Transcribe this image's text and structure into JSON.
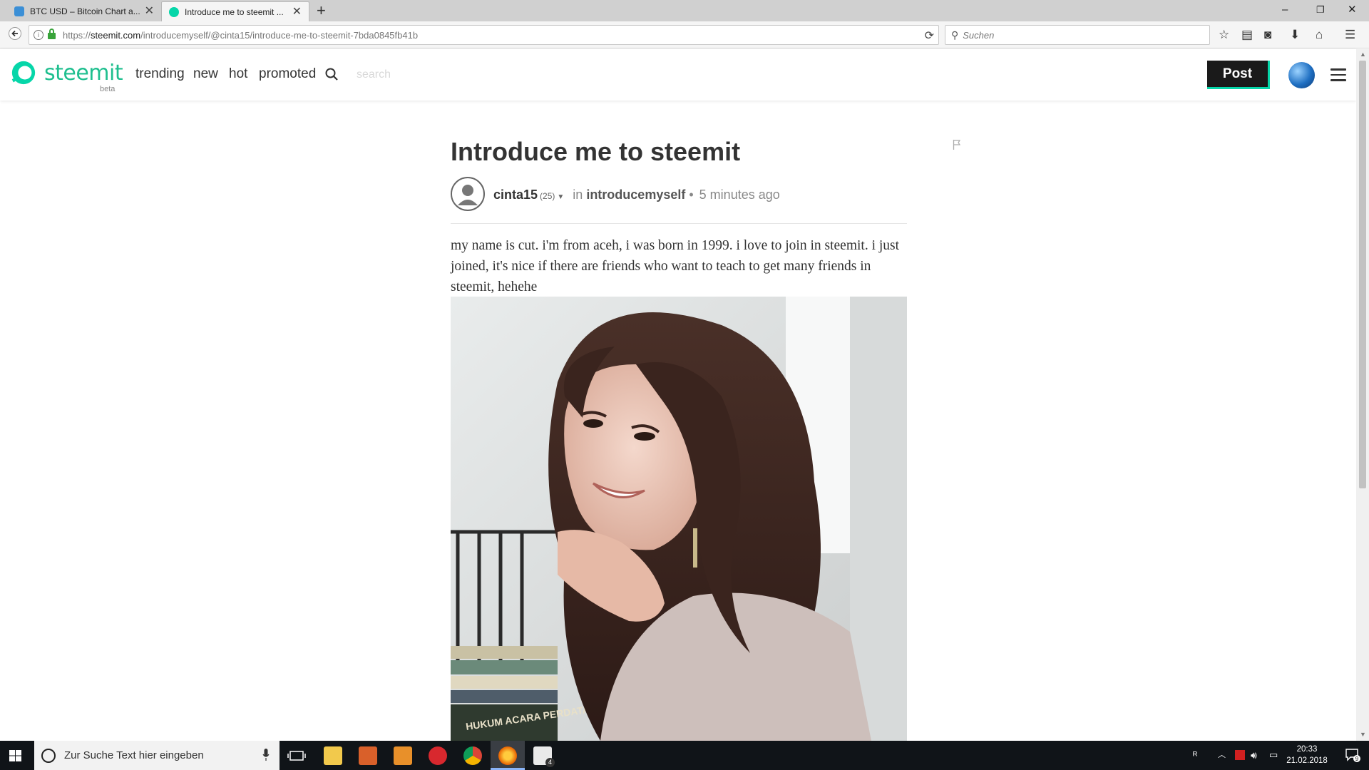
{
  "browser": {
    "tabs": [
      {
        "title": "BTC USD – Bitcoin Chart a...",
        "favicon_color": "#3b8fd6",
        "active": false
      },
      {
        "title": "Introduce me to steemit ...",
        "favicon_color": "#06d6a9",
        "active": true
      }
    ],
    "url": {
      "prefix": "https://",
      "host": "steemit.com",
      "path": "/introducemyself/@cinta15/introduce-me-to-steemit-7bda0845fb41b"
    },
    "search_placeholder": "Suchen"
  },
  "site": {
    "logo_word": "steemit",
    "logo_beta": "beta",
    "brand_color": "#06d6a9",
    "nav": [
      "trending",
      "new",
      "hot",
      "promoted"
    ],
    "search_placeholder": "search",
    "post_button": "Post"
  },
  "post": {
    "title": "Introduce me to steemit",
    "author": "cinta15",
    "reputation": "(25)",
    "in_label": "in",
    "category": "introducemyself",
    "separator": "•",
    "time_ago": "5 minutes ago",
    "body": "my name is cut. i'm from aceh, i was born in 1999. i love to join in steemit. i just joined, it's nice if there are friends who want to teach to get many friends in steemit, hehehe",
    "image_text": "HUKUM ACARA PERDATA"
  },
  "taskbar": {
    "search_placeholder": "Zur Suche Text hier eingeben",
    "time": "20:33",
    "date": "21.02.2018",
    "mail_badge": "4",
    "notification_count": "9"
  }
}
